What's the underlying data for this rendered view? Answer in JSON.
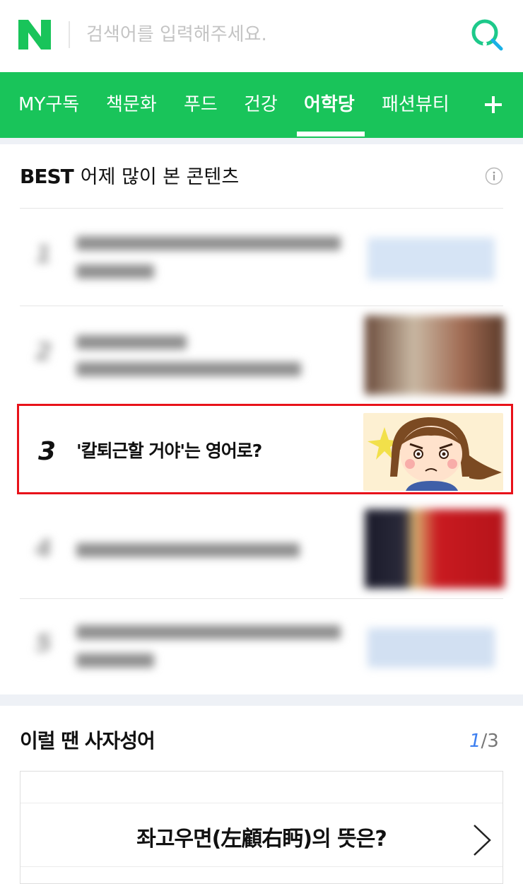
{
  "header": {
    "logo_alt": "N",
    "search_placeholder": "검색어를 입력해주세요.",
    "search_icon": "search-icon"
  },
  "nav": {
    "tabs": [
      {
        "label": "MY구독",
        "active": false
      },
      {
        "label": "책문화",
        "active": false
      },
      {
        "label": "푸드",
        "active": false
      },
      {
        "label": "건강",
        "active": false
      },
      {
        "label": "어학당",
        "active": true
      },
      {
        "label": "패션뷰티",
        "active": false
      }
    ],
    "add_icon": "plus-icon"
  },
  "best": {
    "badge": "BEST",
    "title": "어제 많이 본 콘텐츠",
    "info_icon": "info-icon",
    "items": [
      {
        "rank": "1",
        "blurred": true
      },
      {
        "rank": "2",
        "blurred": true
      },
      {
        "rank": "3",
        "title": "'칼퇴근할 거야'는 영어로?",
        "blurred": false
      },
      {
        "rank": "4",
        "blurred": true
      },
      {
        "rank": "5",
        "blurred": true
      }
    ]
  },
  "idiom": {
    "title": "이럴 땐 사자성어",
    "page_current": "1",
    "page_total": "/3",
    "question": "좌고우면(左顧右眄)의 뜻은?",
    "next_icon": "chevron-right-icon"
  },
  "colors": {
    "brand_green": "#19c45a",
    "highlight_red": "#e8121a",
    "pager_blue": "#3d7ff0"
  }
}
